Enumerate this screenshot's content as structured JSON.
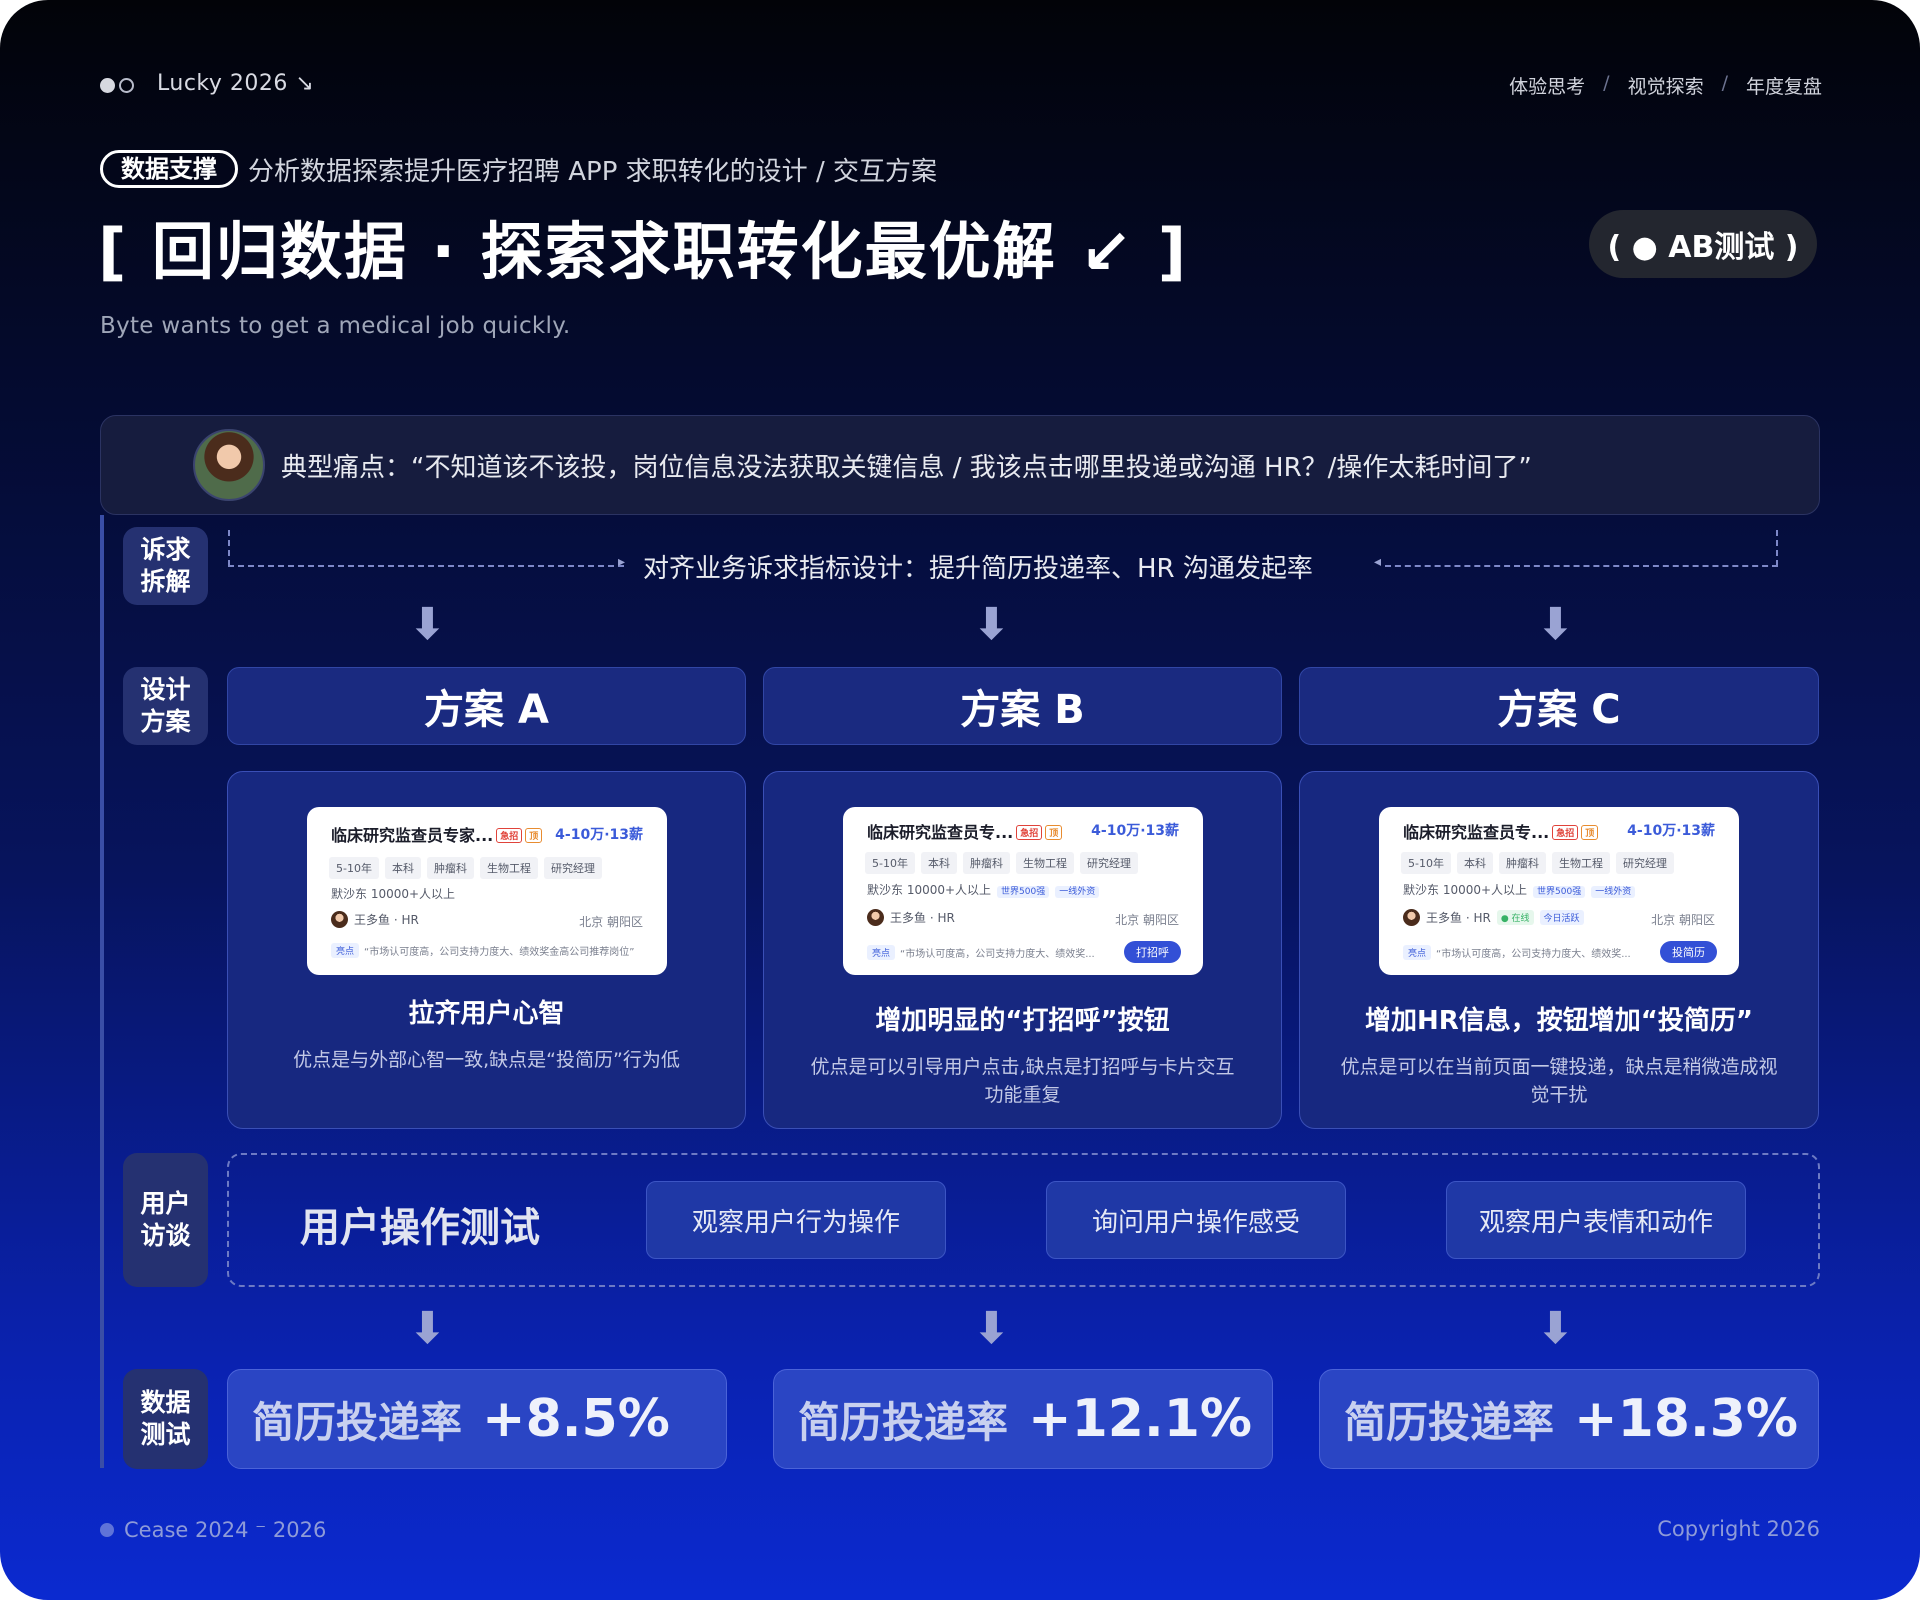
{
  "header": {
    "brand": "Lucky 2026 ↘",
    "nav": [
      "体验思考",
      "视觉探索",
      "年度复盘"
    ],
    "tag_pill": "数据支撑",
    "subtitle": "分析数据探索提升医疗招聘 APP 求职转化的设计 / 交互方案",
    "title": "[ 回归数据 · 探索求职转化最优解 ↙ ]",
    "english": "Byte wants to get a medical job quickly.",
    "ab_pill": "( ● AB测试 )"
  },
  "pain_point": {
    "text": "典型痛点：“不知道该不该投，岗位信息没法获取关键信息 / 我该点击哪里投递或沟通 HR？/操作太耗时间了”"
  },
  "side_labels": {
    "demand": "诉求\n拆解",
    "design": "设计\n方案",
    "interview": "用户\n访谈",
    "data": "数据\n测试"
  },
  "alignment": {
    "text": "对齐业务诉求指标设计：提升简历投递率、HR 沟通发起率"
  },
  "arrow_glyph": "⬇",
  "plans": [
    {
      "name": "方案 A",
      "title": "拉齐用户心智",
      "desc": "优点是与外部心智一致,缺点是“投简历”行为低",
      "card": {
        "job": "临床研究监查员专家...",
        "badge_urgent": "急招",
        "badge_top": "顶",
        "salary": "4-10万·13薪",
        "tags": [
          "5-10年",
          "本科",
          "肿瘤科",
          "生物工程",
          "研究经理"
        ],
        "company": "默沙东 10000+人以上",
        "company_tags": [],
        "hr": "王多鱼 · HR",
        "hr_status": [],
        "location": "北京 朝阳区",
        "highlight_label": "亮点",
        "highlight": "“市场认可度高，公司支持力度大、绩效奖金高公司推荐岗位”",
        "button": ""
      }
    },
    {
      "name": "方案 B",
      "title": "增加明显的“打招呼”按钮",
      "desc": "优点是可以引导用户点击,缺点是打招呼与卡片交互功能重复",
      "card": {
        "job": "临床研究监查员专...",
        "badge_urgent": "急招",
        "badge_top": "顶",
        "salary": "4-10万·13薪",
        "tags": [
          "5-10年",
          "本科",
          "肿瘤科",
          "生物工程",
          "研究经理"
        ],
        "company": "默沙东 10000+人以上",
        "company_tags": [
          "世界500强",
          "一线外资"
        ],
        "hr": "王多鱼 · HR",
        "hr_status": [],
        "location": "北京 朝阳区",
        "highlight_label": "亮点",
        "highlight": "“市场认可度高，公司支持力度大、绩效奖...",
        "button": "打招呼"
      }
    },
    {
      "name": "方案 C",
      "title": "增加HR信息，按钮增加“投简历”",
      "desc": "优点是可以在当前页面一键投递，缺点是稍微造成视觉干扰",
      "card": {
        "job": "临床研究监查员专...",
        "badge_urgent": "急招",
        "badge_top": "顶",
        "salary": "4-10万·13薪",
        "tags": [
          "5-10年",
          "本科",
          "肿瘤科",
          "生物工程",
          "研究经理"
        ],
        "company": "默沙东 10000+人以上",
        "company_tags": [
          "世界500强",
          "一线外资"
        ],
        "hr": "王多鱼 · HR",
        "hr_status": [
          "● 在线",
          "今日活跃"
        ],
        "location": "北京 朝阳区",
        "highlight_label": "亮点",
        "highlight": "“市场认可度高，公司支持力度大、绩效奖...",
        "button": "投简历"
      }
    }
  ],
  "user_test": {
    "title": "用户操作测试",
    "items": [
      "观察用户行为操作",
      "询问用户操作感受",
      "观察用户表情和动作"
    ]
  },
  "results": [
    {
      "label": "简历投递率",
      "value": "+8.5%"
    },
    {
      "label": "简历投递率",
      "value": "+12.1%"
    },
    {
      "label": "简历投递率",
      "value": "+18.3%"
    }
  ],
  "footer": {
    "left": "Cease 2024 ⁻ 2026",
    "right": "Copyright 2026"
  },
  "colors": {
    "background_top": "#020308",
    "background_bottom": "#0b2ad0",
    "accent": "#3350d6"
  }
}
